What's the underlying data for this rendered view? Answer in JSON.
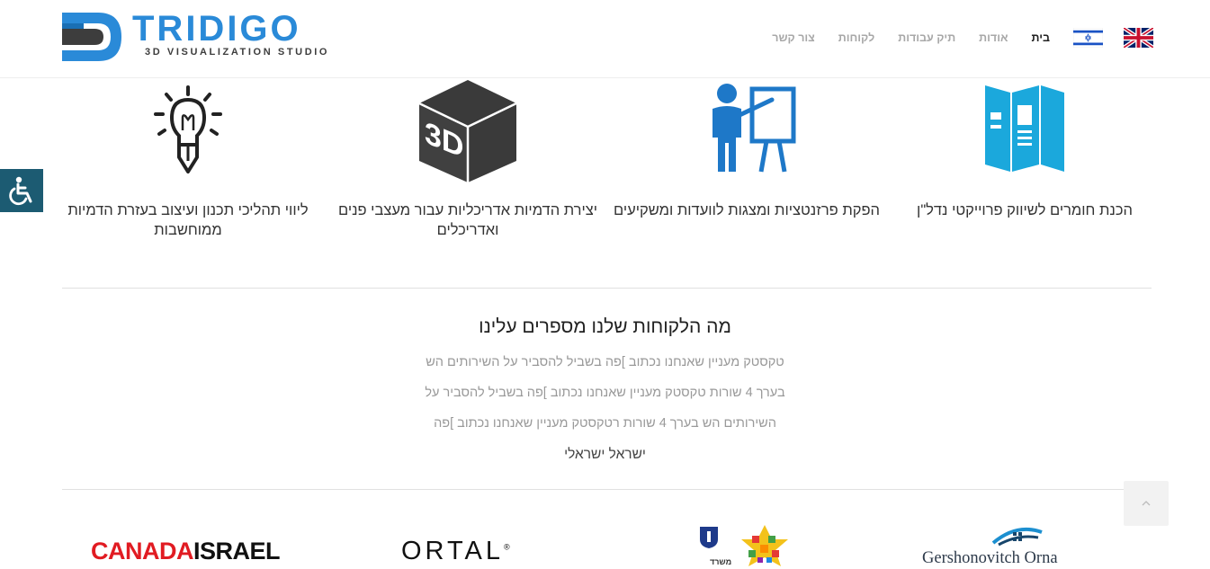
{
  "header": {
    "logo": {
      "name": "TRIDIGO",
      "tagline": "3D VISUALIZATION STUDIO"
    },
    "flags": [
      {
        "icon": "uk-flag-icon"
      },
      {
        "icon": "israel-flag-icon"
      }
    ],
    "nav": [
      {
        "label": "בית",
        "active": true
      },
      {
        "label": "אודות",
        "active": false
      },
      {
        "label": "תיק עבודות",
        "active": false
      },
      {
        "label": "לקוחות",
        "active": false
      },
      {
        "label": "צור קשר",
        "active": false
      }
    ]
  },
  "accessibility": {
    "icon": "wheelchair-icon"
  },
  "services": [
    {
      "icon": "brochure-icon",
      "title": "הכנת חומרים לשיווק פרוייקטי נדל\"ן"
    },
    {
      "icon": "presentation-icon",
      "title": "הפקת פרזנטציות ומצגות לוועדות ומשקיעים"
    },
    {
      "icon": "3d-cube-icon",
      "title": "יצירת הדמיות אדריכליות עבור מעצבי פנים ואדריכלים"
    },
    {
      "icon": "lightbulb-pencil-icon",
      "title": "ליווי תהליכי תכנון ועיצוב בעזרת הדמיות ממוחשבות"
    }
  ],
  "testimonial": {
    "title": "מה הלקוחות שלנו מספרים עלינו",
    "lines": [
      "טקסטק מעניין שאנחנו נכתוב ]פה בשביל להסביר על השירותים הש",
      "בערך 4 שורות טקסטק מעניין שאנחנו נכתוב ]פה בשביל להסביר על",
      "השירותים הש בערך 4 שורות רטקסטק מעניין שאנחנו נכתוב ]פה"
    ],
    "author": "ישראל ישראלי"
  },
  "scroll_top": {
    "icon": "chevron-up-icon"
  },
  "clients": {
    "canada_israel": {
      "part1": "CANADA",
      "part2": "ISRAEL"
    },
    "ortal": {
      "name": "ORTAL",
      "mark": "®"
    },
    "ministry": {
      "label": "משרד"
    },
    "gershonovitch": {
      "name": "Gershonovitch Orna"
    }
  },
  "colors": {
    "brand_blue": "#2a8ad8",
    "brand_dark": "#3d3d3d",
    "icon_blue": "#1e78c8",
    "icon_cyan": "#1ba8dc",
    "accessibility_bg": "#1c5b72",
    "canada_red": "#e11b22"
  }
}
